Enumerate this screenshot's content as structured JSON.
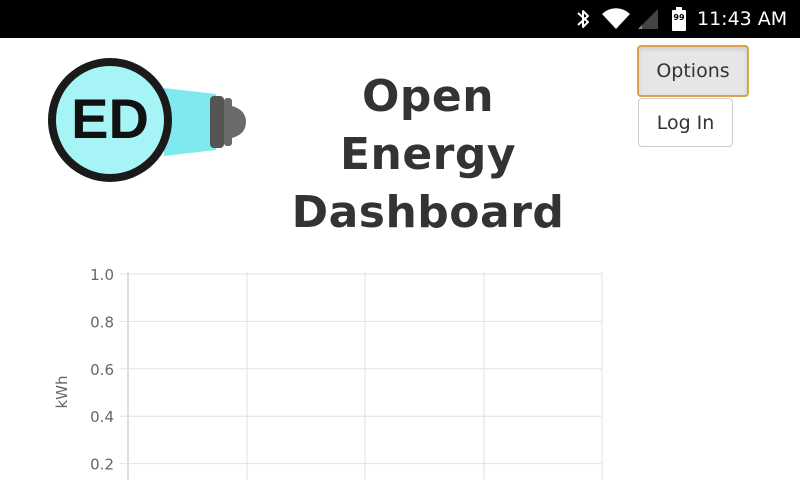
{
  "status_bar": {
    "time": "11:43 AM",
    "battery_level": "99",
    "icons": [
      "bluetooth-icon",
      "wifi-icon",
      "signal-icon",
      "battery-icon"
    ]
  },
  "header": {
    "logo_text": "ED",
    "title_lines": [
      "Open",
      "Energy",
      "Dashboard"
    ]
  },
  "buttons": {
    "options_label": "Options",
    "login_label": "Log In"
  },
  "colors": {
    "logo_fill": "#a7f4f7",
    "bulb_glow": "#7eeaf0",
    "options_border": "#d9a441",
    "title_color": "#333333"
  },
  "chart_data": {
    "type": "line",
    "ylabel": "kWh",
    "ylim": [
      0,
      1.0
    ],
    "y_ticks": [
      "1.0",
      "0.8",
      "0.6",
      "0.4",
      "0.2"
    ],
    "grid": true,
    "series": []
  }
}
